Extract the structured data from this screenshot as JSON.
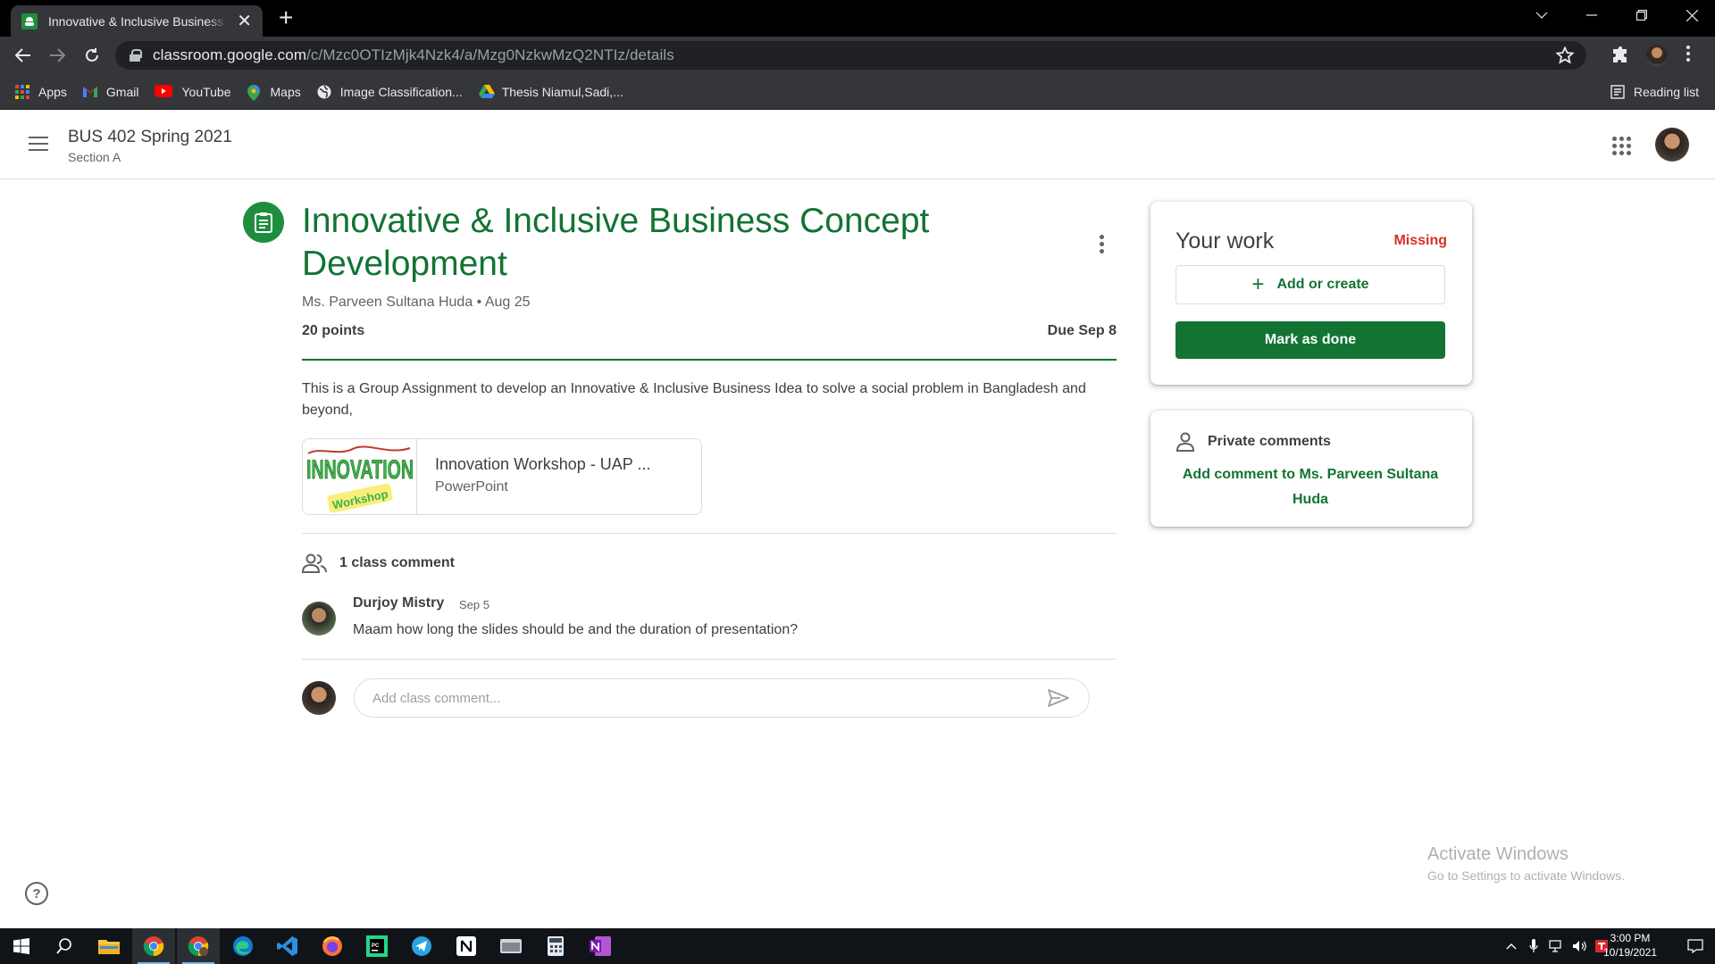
{
  "browser": {
    "tab_title": "Innovative & Inclusive Business Concept Development",
    "url_host": "classroom.google.com",
    "url_path": "/c/Mzc0OTIzMjk4Nzk4/a/Mzg0NzkwMzQ2NTIz/details",
    "bookmarks": [
      {
        "label": "Apps",
        "icon": "apps-grid-icon"
      },
      {
        "label": "Gmail",
        "icon": "gmail-icon"
      },
      {
        "label": "YouTube",
        "icon": "youtube-icon"
      },
      {
        "label": "Maps",
        "icon": "maps-icon"
      },
      {
        "label": "Image Classification...",
        "icon": "globe-icon"
      },
      {
        "label": "Thesis Niamul,Sadi,...",
        "icon": "drive-icon"
      }
    ],
    "reading_list": "Reading list"
  },
  "header": {
    "class_title": "BUS 402 Spring 2021",
    "class_section": "Section A"
  },
  "assignment": {
    "title": "Innovative & Inclusive Business Concept Development",
    "author": "Ms. Parveen Sultana Huda",
    "posted": "Aug 25",
    "meta_separator": "•",
    "points": "20 points",
    "due": "Due Sep 8",
    "description": "This is a Group Assignment to develop an Innovative & Inclusive Business Idea to solve a social problem in Bangladesh and beyond,",
    "attachment": {
      "title": "Innovation Workshop - UAP ...",
      "type": "PowerPoint",
      "thumb_word": "INNOVATION",
      "thumb_sub": "Workshop"
    }
  },
  "comments": {
    "count_label": "1 class comment",
    "items": [
      {
        "author": "Durjoy Mistry",
        "date": "Sep 5",
        "text": "Maam how long the slides should be and the duration of presentation?"
      }
    ],
    "input_placeholder": "Add class comment..."
  },
  "your_work": {
    "title": "Your work",
    "status": "Missing",
    "add_label": "Add or create",
    "add_plus": "+",
    "done_label": "Mark as done"
  },
  "private_comments": {
    "title": "Private comments",
    "link": "Add comment to Ms. Parveen Sultana Huda"
  },
  "help": "?",
  "activation": {
    "line1": "Activate Windows",
    "line2": "Go to Settings to activate Windows."
  },
  "taskbar": {
    "time": "3:00 PM",
    "date": "10/19/2021"
  },
  "colors": {
    "classroom_green": "#137333",
    "missing_red": "#d93025",
    "chrome_dark": "#35363a"
  }
}
